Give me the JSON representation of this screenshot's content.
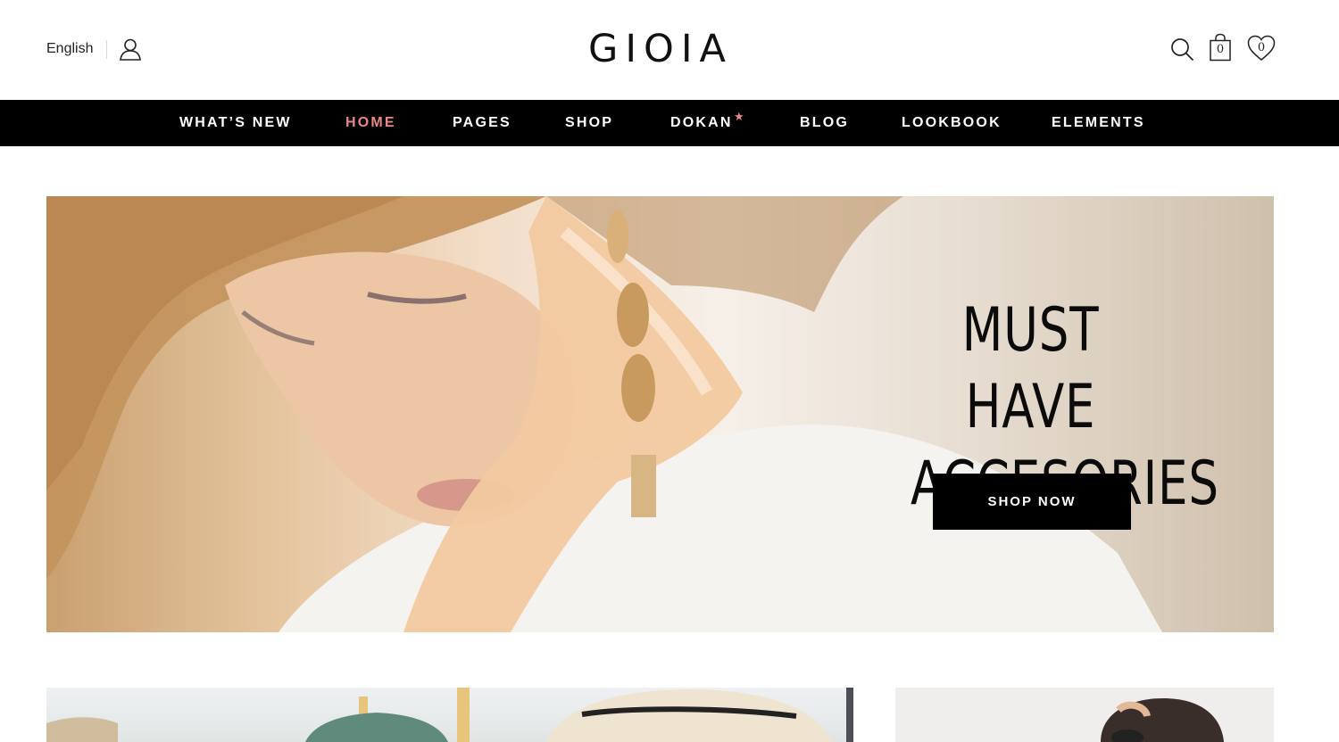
{
  "header": {
    "language": "English",
    "logo": "GIOIA",
    "cart_count": "0",
    "wishlist_count": "0",
    "icons": [
      "user-icon",
      "search-icon",
      "cart-icon",
      "wishlist-heart-icon"
    ]
  },
  "nav": {
    "items": [
      {
        "label": "WHAT’S NEW"
      },
      {
        "label": "HOME",
        "active": true
      },
      {
        "label": "PAGES"
      },
      {
        "label": "SHOP"
      },
      {
        "label": "DOKAN",
        "badge": "★"
      },
      {
        "label": "BLOG"
      },
      {
        "label": "LOOKBOOK"
      },
      {
        "label": "ELEMENTS"
      }
    ]
  },
  "hero": {
    "title_line1": "MUST HAVE",
    "title_line2": "ACCESORIES",
    "button": "SHOP NOW"
  },
  "colors": {
    "accent": "#ec8787",
    "nav_bg": "#000000",
    "button_bg": "#000000"
  }
}
